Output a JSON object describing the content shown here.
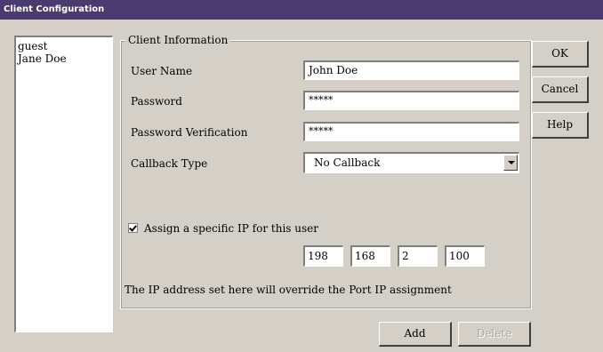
{
  "window": {
    "title": "Client Configuration"
  },
  "users": {
    "items": [
      "guest",
      "Jane Doe"
    ]
  },
  "client_info": {
    "legend": "Client Information",
    "user_name_label": "User Name",
    "user_name_value": "John Doe",
    "password_label": "Password",
    "password_value": "*****",
    "password_verify_label": "Password Verification",
    "password_verify_value": "*****",
    "callback_label": "Callback Type",
    "callback_value": "No Callback",
    "assign_ip_label": "Assign a specific IP for this user",
    "assign_ip_checked": true,
    "ip": [
      "198",
      "168",
      "2",
      "100"
    ],
    "note": "The IP address set here will override the Port IP assignment"
  },
  "buttons": {
    "ok": "OK",
    "cancel": "Cancel",
    "help": "Help",
    "add": "Add",
    "delete": "Delete"
  }
}
